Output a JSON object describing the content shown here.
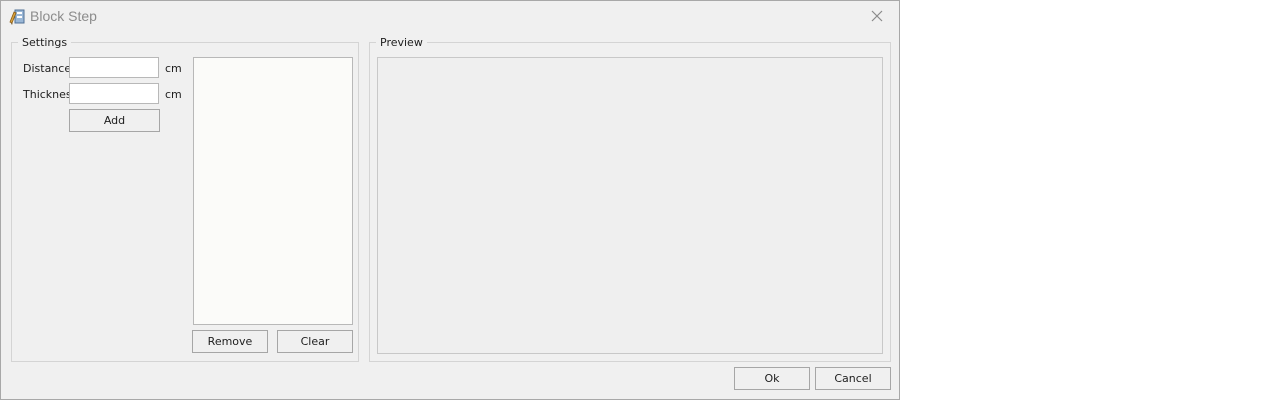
{
  "window": {
    "title": "Block Step",
    "icon": "block-step-app-icon"
  },
  "settings": {
    "legend": "Settings",
    "distance_label": "Distance:",
    "distance_value": "",
    "distance_unit": "cm",
    "thickness_label": "Thickness",
    "thickness_value": "",
    "thickness_unit": "cm",
    "add_label": "Add",
    "list_items": [],
    "remove_label": "Remove",
    "clear_label": "Clear"
  },
  "preview": {
    "legend": "Preview"
  },
  "footer": {
    "ok_label": "Ok",
    "cancel_label": "Cancel"
  },
  "colors": {
    "window_bg": "#f0f0f0",
    "list_bg": "#fbfbf9",
    "title_text": "#8c8c8c"
  }
}
